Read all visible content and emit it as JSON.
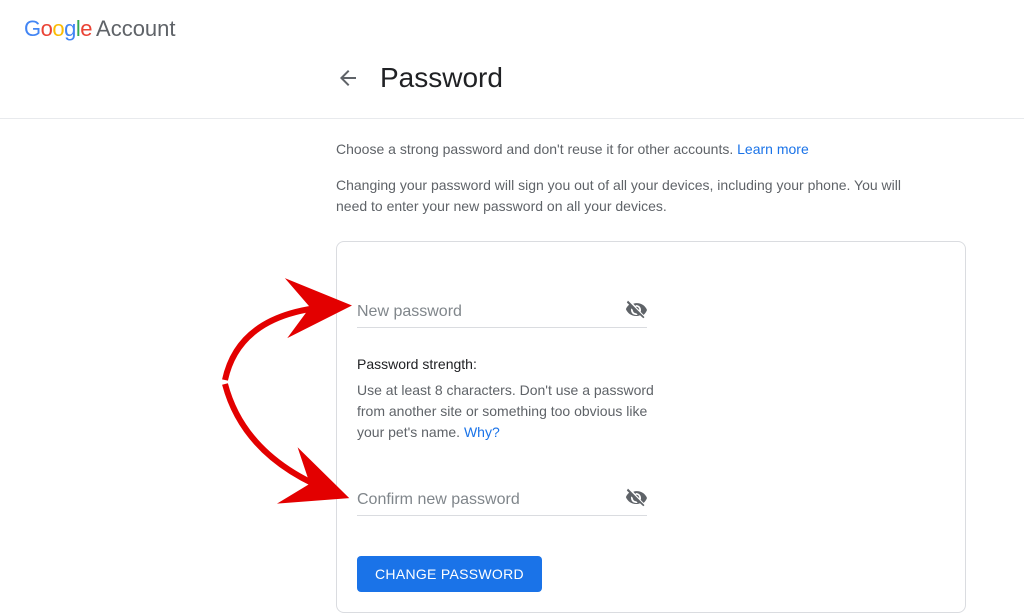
{
  "header": {
    "logo_letters": [
      "G",
      "o",
      "o",
      "g",
      "l",
      "e"
    ],
    "account_label": "Account"
  },
  "title_bar": {
    "page_title": "Password"
  },
  "instructions": {
    "line1": "Choose a strong password and don't reuse it for other accounts. ",
    "learn_more": "Learn more",
    "line2": "Changing your password will sign you out of all your devices, including your phone. You will need to enter your new password on all your devices."
  },
  "fields": {
    "new_password_placeholder": "New password",
    "confirm_placeholder": "Confirm new password"
  },
  "strength": {
    "title": "Password strength:",
    "body": "Use at least 8 characters. Don't use a password from another site or something too obvious like your pet's name. ",
    "why": "Why?"
  },
  "actions": {
    "change_password": "Change Password"
  }
}
